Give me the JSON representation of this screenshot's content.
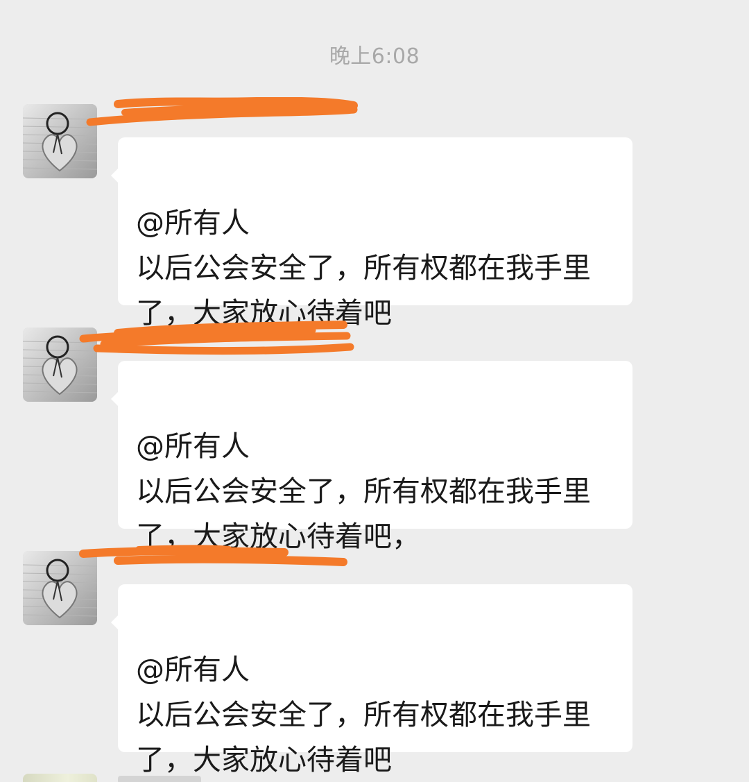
{
  "timestamp": "晚上6:08",
  "messages": [
    {
      "sender": "",
      "mention": "@所有人",
      "body": "以后公会安全了，所有权都在我手里了，大家放心待着吧"
    },
    {
      "sender": "",
      "mention": "@所有人",
      "body": "以后公会安全了，所有权都在我手里了，大家放心待着吧，"
    },
    {
      "sender": "",
      "mention": "@所有人",
      "body": "以后公会安全了，所有权都在我手里了，大家放心待着吧"
    }
  ],
  "colors": {
    "background": "#ededed",
    "bubble": "#ffffff",
    "redaction": "#f47a2a",
    "timestamp": "#a8a8a8"
  },
  "icons": {
    "avatar": "heart-dreamcatcher-avatar"
  }
}
